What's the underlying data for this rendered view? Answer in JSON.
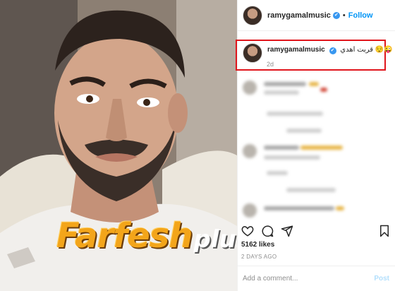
{
  "post": {
    "username": "ramygamalmusic",
    "follow_label": "Follow",
    "separator": "•",
    "caption_text": "قربت اهدي",
    "caption_emoji": "😌😜",
    "caption_time": "2d",
    "likes_text": "5162 likes",
    "date_text": "2 DAYS AGO"
  },
  "watermark": {
    "main": "Farfesh",
    "sub": "plus.com"
  },
  "comment_bar": {
    "placeholder": "Add a comment...",
    "post_label": "Post"
  },
  "icons": {
    "verified": "✔",
    "like": "heart-icon",
    "comment": "comment-icon",
    "share": "share-icon",
    "save": "bookmark-icon"
  },
  "colors": {
    "accent": "#0095f6",
    "highlight_border": "#e0151c",
    "watermark_orange": "#f3a51a"
  }
}
